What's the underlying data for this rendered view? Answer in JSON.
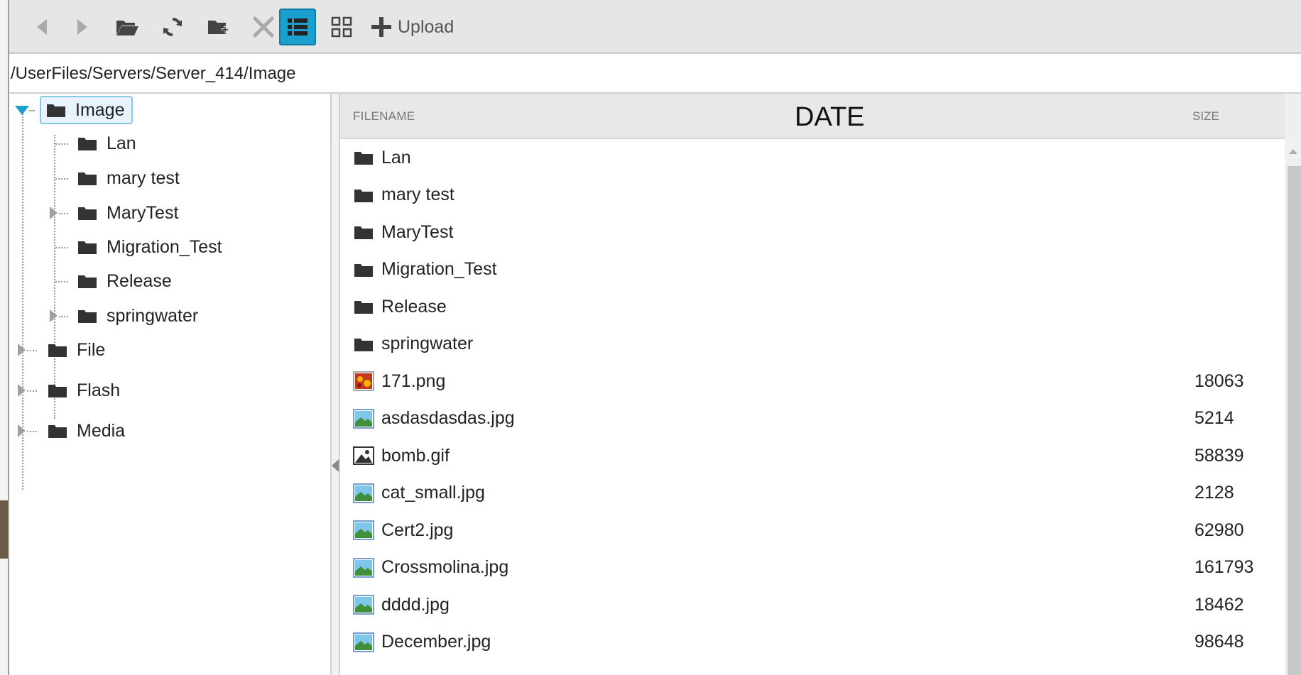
{
  "toolbar": {
    "upload_label": "Upload"
  },
  "path": "/UserFiles/Servers/Server_414/Image",
  "tree": {
    "root": "Image",
    "children": [
      "Lan",
      "mary test",
      "MaryTest",
      "Migration_Test",
      "Release",
      "springwater"
    ],
    "siblings": [
      "File",
      "Flash",
      "Media"
    ]
  },
  "list": {
    "columns": {
      "filename": "FILENAME",
      "date": "DATE",
      "size": "SIZE"
    },
    "folders": [
      "Lan",
      "mary test",
      "MaryTest",
      "Migration_Test",
      "Release",
      "springwater"
    ],
    "files": [
      {
        "name": "171.png",
        "size": "18063",
        "icon": "png-thumbnail-icon"
      },
      {
        "name": "asdasdasdas.jpg",
        "size": "5214",
        "icon": "jpg-image-icon"
      },
      {
        "name": "bomb.gif",
        "size": "58839",
        "icon": "gif-image-icon"
      },
      {
        "name": "cat_small.jpg",
        "size": "2128",
        "icon": "jpg-image-icon"
      },
      {
        "name": "Cert2.jpg",
        "size": "62980",
        "icon": "jpg-image-icon"
      },
      {
        "name": "Crossmolina.jpg",
        "size": "161793",
        "icon": "jpg-image-icon"
      },
      {
        "name": "dddd.jpg",
        "size": "18462",
        "icon": "jpg-image-icon"
      },
      {
        "name": "December.jpg",
        "size": "98648",
        "icon": "jpg-image-icon"
      }
    ]
  },
  "colors": {
    "accent": "#1a9fcf",
    "folder": "#333333",
    "toolbar_bg": "#e6e6e6",
    "icon_gray": "#555555"
  }
}
